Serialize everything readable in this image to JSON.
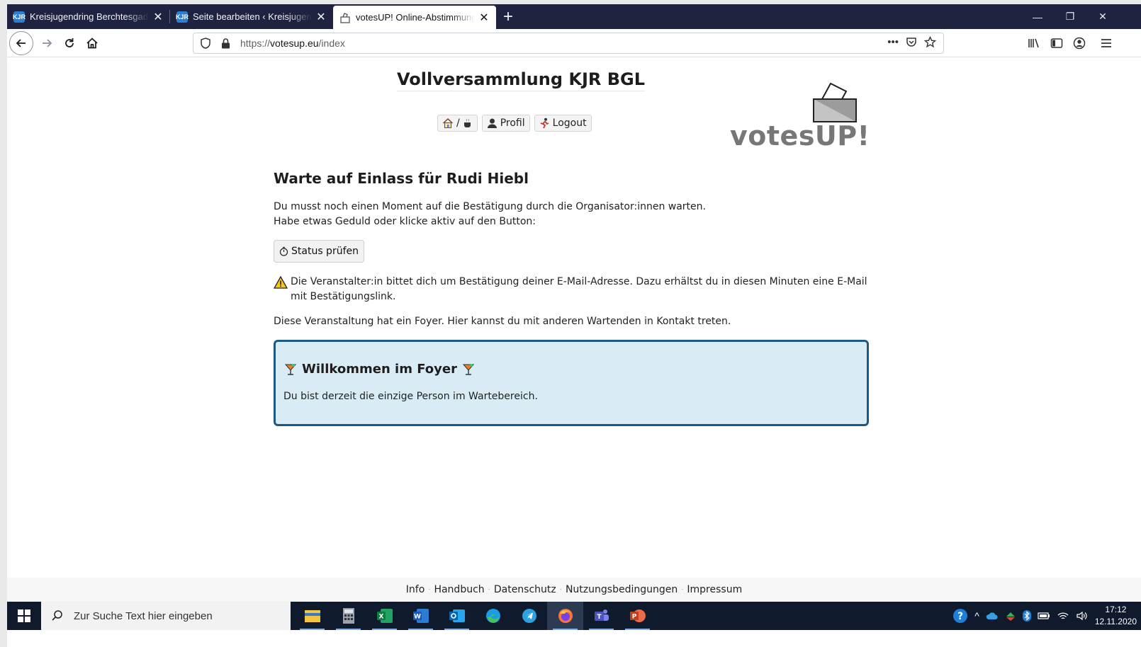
{
  "browser": {
    "tabs": [
      {
        "title": "Kreisjugendring Berchtesgadener Land",
        "favicon": "kjr-icon"
      },
      {
        "title": "Seite bearbeiten ‹ Kreisjugendring",
        "favicon": "kjr-icon"
      },
      {
        "title": "votesUP! Online-Abstimmungen",
        "favicon": "ballot-icon"
      }
    ],
    "active_tab": 2,
    "url_scheme": "https://",
    "url_host": "votesup.eu",
    "url_path": "/index"
  },
  "site": {
    "title": "Vollversammlung KJR BGL",
    "logo_text": "votesUP!",
    "nav": {
      "home_sep": "/",
      "profile": "Profil",
      "logout": "Logout"
    }
  },
  "main": {
    "heading": "Warte auf Einlass für Rudi Hiebl",
    "wait_line1": "Du musst noch einen Moment auf die Bestätigung durch die Organisator:innen warten.",
    "wait_line2": "Habe etwas Geduld oder klicke aktiv auf den Button:",
    "status_button": "Status prüfen",
    "warning": "Die Veranstalter:in bittet dich um Bestätigung deiner E-Mail-Adresse. Dazu erhältst du in diesen Minuten eine E-Mail mit Bestätigungslink.",
    "foyer_note": "Diese Veranstaltung hat ein Foyer. Hier kannst du mit anderen Wartenden in Kontakt treten.",
    "foyer": {
      "title": "Willkommen im Foyer",
      "message": "Du bist derzeit die einzige Person im Wartebereich."
    }
  },
  "footer": {
    "links": [
      "Info",
      "Handbuch",
      "Datenschutz",
      "Nutzungsbedingungen",
      "Impressum"
    ]
  },
  "taskbar": {
    "search_placeholder": "Zur Suche Text hier eingeben",
    "time": "17:12",
    "date": "12.11.2020"
  },
  "colors": {
    "foyer_border": "#1c5a86",
    "foyer_bg": "#d9ecf5",
    "tabstrip": "#202340"
  }
}
